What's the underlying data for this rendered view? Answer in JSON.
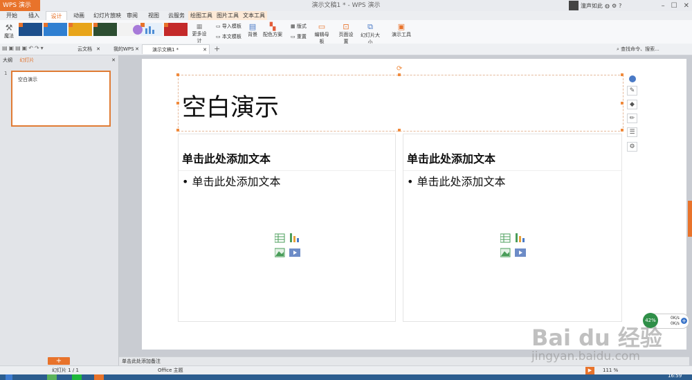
{
  "app": {
    "wps_button": "WPS 演示",
    "doc_title": "演示文稿1 * - WPS 演示",
    "user_name": "潼声如此"
  },
  "menu": [
    "开始",
    "插入",
    "设计",
    "动画",
    "幻灯片放映",
    "审阅",
    "视图",
    "云服务",
    "绘图工具",
    "图片工具",
    "文本工具"
  ],
  "ribbon": {
    "magic": "魔法",
    "more_design": "更多设计",
    "import_template": "导入模板",
    "this_template": "本文模板",
    "background": "背景",
    "color_scheme": "配色方案",
    "layout": "版式",
    "reset": "重置",
    "edit_master": "编辑母板",
    "page_setup": "页面设置",
    "slide_size": "幻灯片大小",
    "presentation_tools": "演示工具"
  },
  "quick": {
    "tabs": [
      "云文档",
      "我的WPS",
      "演示文稿1 *"
    ],
    "search_placeholder": "查找命令、搜索..."
  },
  "left_panel": {
    "tab_outline": "大纲",
    "tab_slides": "幻灯片",
    "slide_number": "1",
    "slide_thumb_title": "空白演示"
  },
  "slide": {
    "title": "空白演示",
    "left_heading": "单击此处添加文本",
    "left_bullet": "单击此处添加文本",
    "right_heading": "单击此处添加文本",
    "right_bullet": "单击此处添加文本"
  },
  "notes_placeholder": "单击此处添加备注",
  "status": {
    "slide_counter": "幻灯片 1 / 1",
    "theme": "Office 主题",
    "zoom": "111 %"
  },
  "overlay": {
    "percent": "42%",
    "speed_up": "0K/s",
    "speed_down": "0K/s",
    "clock": "16:59"
  },
  "watermark": {
    "brand": "Bai du 经验",
    "url": "jingyan.baidu.com"
  },
  "colors": {
    "accent": "#e8732b",
    "handle": "#f08a3c"
  }
}
